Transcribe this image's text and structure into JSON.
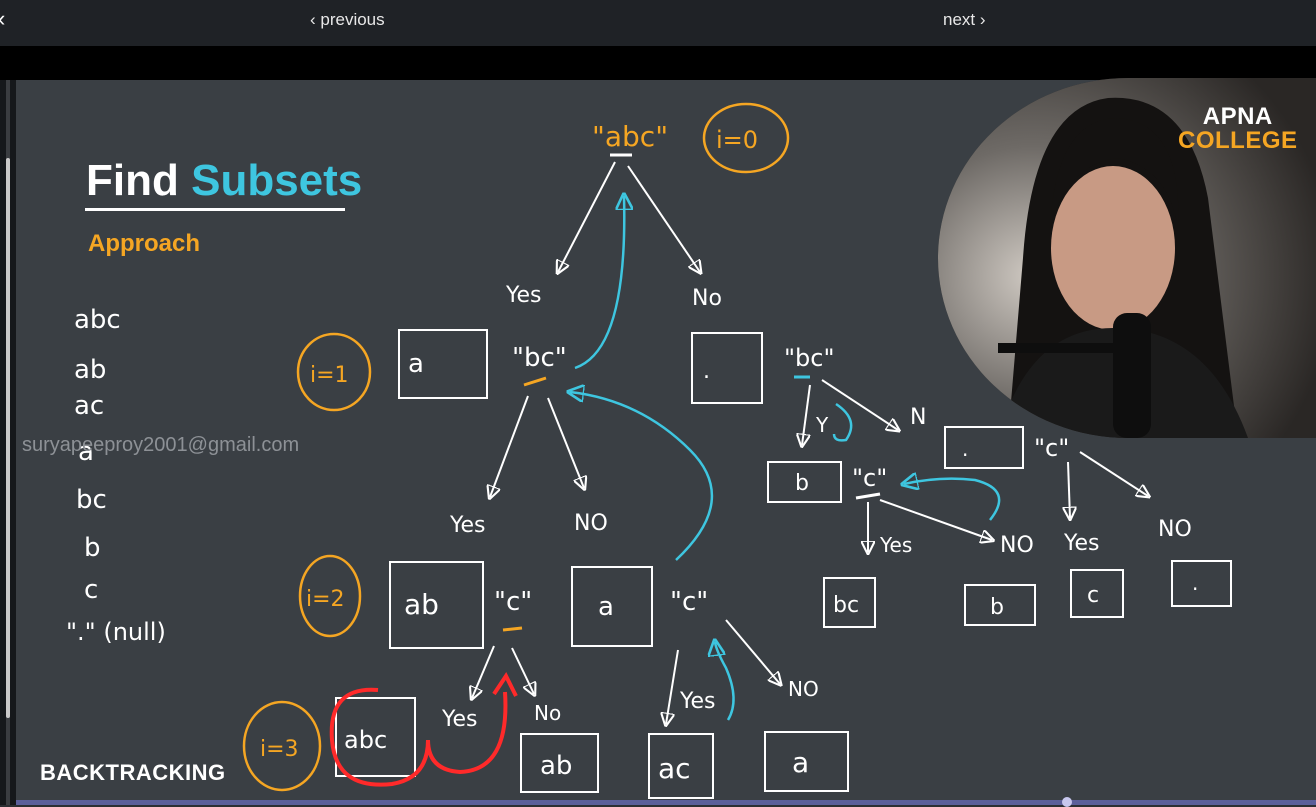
{
  "nav": {
    "previous_label": "‹ previous",
    "next_label": "next ›",
    "back_icon": "‹"
  },
  "slide": {
    "title_part1": "Find ",
    "title_part2": "Subsets",
    "subtitle": "Approach",
    "footer_label": "BACKTRACKING"
  },
  "watermark": "suryapeeproy2001@gmail.com",
  "logo": {
    "line1": "APNA",
    "line2": "COLLEGE"
  },
  "colors": {
    "accent_orange": "#f5a623",
    "accent_cyan": "#3ec6e0",
    "highlight_red": "#ff2a2a",
    "board": "#3a3f44"
  },
  "subset_list": [
    "abc",
    "ab",
    "ac",
    "a",
    "bc",
    "b",
    "c",
    "\".\" (null)"
  ],
  "tree": {
    "root": "\"abc\"",
    "root_index": "i=0",
    "index_1": "i=1",
    "index_2": "i=2",
    "index_3": "i=3",
    "yes": "Yes",
    "no": "NO",
    "no_short": "No",
    "n_short": "N",
    "y_short": "Y",
    "str_bc": "\"bc\"",
    "str_c": "\"c\"",
    "box_a": "a",
    "box_dot": ".",
    "box_b": "b",
    "box_ab": "ab",
    "box_abc": "abc",
    "box_ac": "ac",
    "box_bc": "bc",
    "box_c": "c"
  }
}
